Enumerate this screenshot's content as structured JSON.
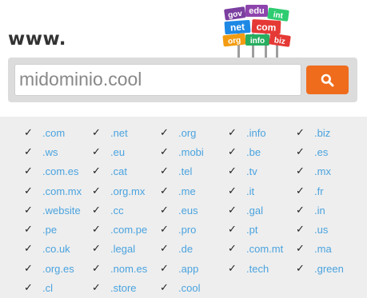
{
  "header": {
    "prefix": "www."
  },
  "logo": {
    "signs": [
      {
        "text": "gov",
        "color": "#7b3fa0"
      },
      {
        "text": "edu",
        "color": "#8e44ad"
      },
      {
        "text": "int",
        "color": "#2ecc71"
      },
      {
        "text": "net",
        "color": "#1e88e5"
      },
      {
        "text": "com",
        "color": "#e53935"
      },
      {
        "text": "org",
        "color": "#f39c12"
      },
      {
        "text": "info",
        "color": "#27ae60"
      },
      {
        "text": "biz",
        "color": "#e53935"
      }
    ]
  },
  "search": {
    "value": "midominio.cool",
    "button_icon": "search-icon",
    "accent": "#ef6c1d"
  },
  "domains": {
    "check_glyph": "✓",
    "items": [
      ".com",
      ".net",
      ".org",
      ".info",
      ".biz",
      ".ws",
      ".eu",
      ".mobi",
      ".be",
      ".es",
      ".com.es",
      ".cat",
      ".tel",
      ".tv",
      ".mx",
      ".com.mx",
      ".org.mx",
      ".me",
      ".it",
      ".fr",
      ".website",
      ".cc",
      ".eus",
      ".gal",
      ".in",
      ".pe",
      ".com.pe",
      ".pro",
      ".pt",
      ".us",
      ".co.uk",
      ".legal",
      ".de",
      ".com.mt",
      ".ma",
      ".org.es",
      ".nom.es",
      ".app",
      ".tech",
      ".green",
      ".cl",
      ".store",
      ".cool"
    ],
    "link_color": "#4aa3df"
  }
}
